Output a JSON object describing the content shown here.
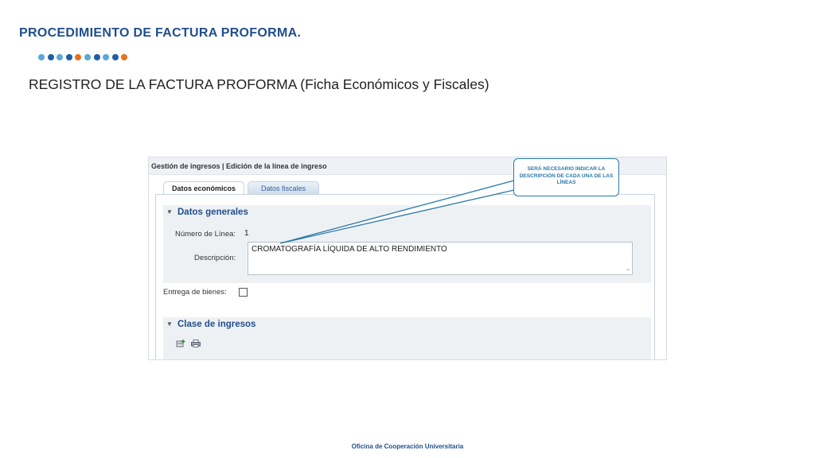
{
  "slide": {
    "title": "PROCEDIMIENTO DE FACTURA PROFORMA.",
    "subtitle": "REGISTRO DE LA FACTURA PROFORMA (Ficha Económicos y Fiscales)",
    "footer": "Oficina de Cooperación Universitaria",
    "dot_colors": [
      "#5aa8d8",
      "#1f5fa8",
      "#5aa8d8",
      "#1f5fa8",
      "#e8701e",
      "#5aa8d8",
      "#1f5fa8",
      "#5aa8d8",
      "#1f5fa8",
      "#e8701e"
    ]
  },
  "window": {
    "title": "Gestión de ingresos | Edición de la línea de ingreso"
  },
  "tabs": {
    "economicos": "Datos económicos",
    "fiscales": "Datos fiscales"
  },
  "datos_generales": {
    "heading": "Datos generales",
    "numero_label": "Número de Línea:",
    "numero_value": "1",
    "descripcion_label": "Descripción:",
    "descripcion_value": "CROMATOGRAFÍA LÍQUIDA DE ALTO RENDIMIENTO"
  },
  "entrega": {
    "label": "Entrega de bienes:",
    "checked": false
  },
  "clase_ingresos": {
    "heading": "Clase de ingresos"
  },
  "callout": {
    "text": "SERÁ NECESARIO INDICAR LA DESCRIPCIÓN DE CADA UNA DE LAS LÍNEAS"
  },
  "colors": {
    "brand_blue": "#1f4e8c",
    "callout_blue": "#2a7aa8"
  },
  "icons": [
    "chevron-down-icon",
    "add-row-icon",
    "print-icon"
  ]
}
